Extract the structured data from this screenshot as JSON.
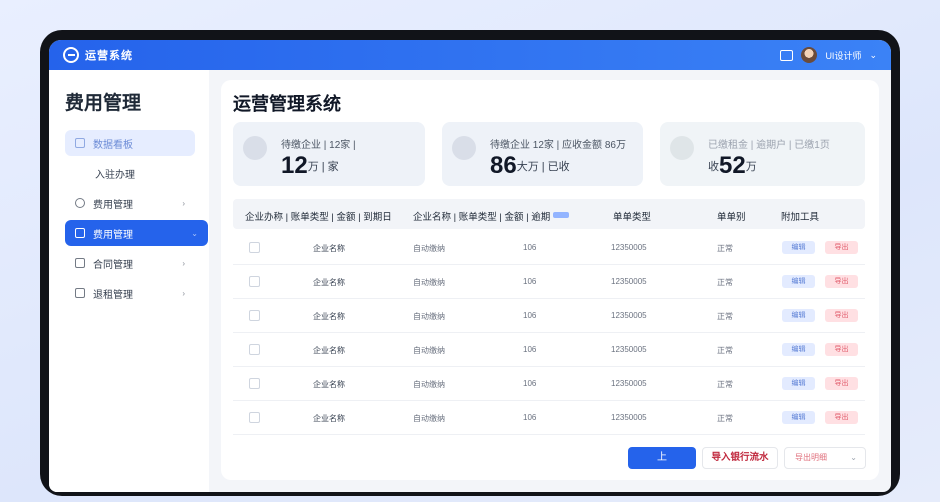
{
  "topbar": {
    "logo_text": "运营系统",
    "user_name": "UI设计师"
  },
  "sidebar": {
    "title": "费用管理",
    "items": [
      {
        "label": "数据看板"
      },
      {
        "label": "入驻办理"
      },
      {
        "label": "费用管理"
      },
      {
        "label": "费用管理"
      },
      {
        "label": "合同管理"
      },
      {
        "label": "退租管理"
      }
    ]
  },
  "main": {
    "title": "运营管理系统",
    "cards": [
      {
        "subtitle": "待缴企业 | 12家 |",
        "value": "12",
        "unit": "万 | 家"
      },
      {
        "subtitle": "待缴企业 12家 | 应收金额 86万",
        "value": "86",
        "unit": "大万 | 已收"
      },
      {
        "subtitle": "已缴租金 | 逾期户 | 已缴1页",
        "value_prefix": "收",
        "value": "52",
        "unit": "万"
      }
    ],
    "table": {
      "headers": [
        "企业办称 | 账单类型 | 金额 | 到期日",
        "企业名称 | 账单类型 | 金额 | 逾期",
        "单单类型",
        "单单别",
        "附加工具"
      ],
      "rows": [
        {
          "name": "企业名称",
          "type": "自动缴纳",
          "amount": "106",
          "date": "12350005",
          "status": "正常",
          "action_a": "编辑",
          "action_b": "导出"
        },
        {
          "name": "企业名称",
          "type": "自动缴纳",
          "amount": "106",
          "date": "12350005",
          "status": "正常",
          "action_a": "编辑",
          "action_b": "导出"
        },
        {
          "name": "企业名称",
          "type": "自动缴纳",
          "amount": "106",
          "date": "12350005",
          "status": "正常",
          "action_a": "编辑",
          "action_b": "导出"
        },
        {
          "name": "企业名称",
          "type": "自动缴纳",
          "amount": "106",
          "date": "12350005",
          "status": "正常",
          "action_a": "编辑",
          "action_b": "导出"
        },
        {
          "name": "企业名称",
          "type": "自动缴纳",
          "amount": "106",
          "date": "12350005",
          "status": "正常",
          "action_a": "编辑",
          "action_b": "导出"
        },
        {
          "name": "企业名称",
          "type": "自动缴纳",
          "amount": "106",
          "date": "12350005",
          "status": "正常",
          "action_a": "编辑",
          "action_b": "导出"
        }
      ]
    },
    "footer": {
      "primary_label": "上",
      "secondary_label": "导入银行流水",
      "select_value": "导出明细"
    }
  }
}
